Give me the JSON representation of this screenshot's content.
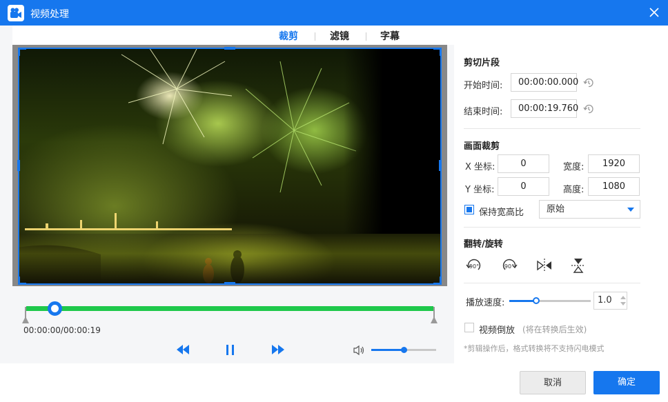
{
  "window": {
    "title": "视频处理"
  },
  "tabs": [
    {
      "label": "裁剪",
      "active": true
    },
    {
      "label": "滤镜",
      "active": false
    },
    {
      "label": "字幕",
      "active": false
    }
  ],
  "player": {
    "time_display": "00:00:00/00:00:19",
    "seek_progress": 0.07,
    "volume_level": 0.5
  },
  "clip": {
    "section_title": "剪切片段",
    "start_label": "开始时间:",
    "start_value": "00:00:00.000",
    "end_label": "结束时间:",
    "end_value": "00:00:19.760"
  },
  "crop": {
    "section_title": "画面裁剪",
    "x_label": "X 坐标:",
    "x_value": "0",
    "y_label": "Y 坐标:",
    "y_value": "0",
    "width_label": "宽度:",
    "width_value": "1920",
    "height_label": "高度:",
    "height_value": "1080",
    "keep_ratio_label": "保持宽高比",
    "keep_ratio_checked": true,
    "ratio_selected": "原始"
  },
  "rotate": {
    "section_title": "翻转/旋转",
    "tools": [
      "rotate-cw-90-icon",
      "rotate-ccw-90-icon",
      "flip-horizontal-icon",
      "flip-vertical-icon"
    ],
    "rotate_text": "90°"
  },
  "speed": {
    "label": "播放速度:",
    "value": "1.0",
    "slider_level": 0.33
  },
  "reverse": {
    "label": "视频倒放",
    "note": "(将在转换后生效)",
    "checked": false
  },
  "hint": "*剪辑操作后，格式转换将不支持闪电模式",
  "buttons": {
    "cancel": "取消",
    "ok": "确定"
  },
  "colors": {
    "accent": "#1677ee",
    "progress": "#1ec84b"
  }
}
